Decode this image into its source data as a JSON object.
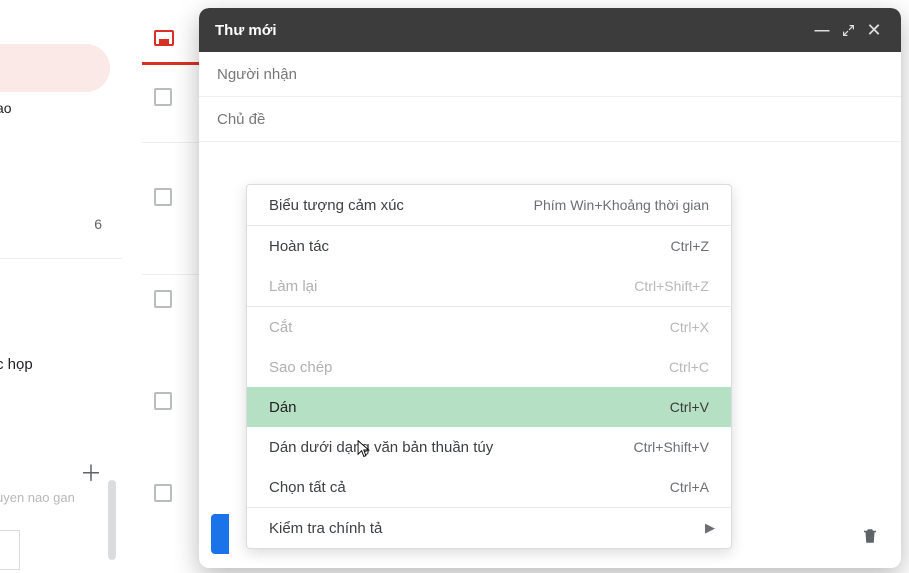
{
  "sidebar": {
    "cut_label_top": "ao",
    "count": "6",
    "category_label": "c họp",
    "cut_label_bottom": "uyen nao gan"
  },
  "compose": {
    "title": "Thư mới",
    "recipients_placeholder": "Người nhận",
    "subject_placeholder": "Chủ đề"
  },
  "ctx": {
    "emoji": {
      "label": "Biểu tượng cảm xúc",
      "shortcut": "Phím Win+Khoảng thời gian"
    },
    "undo": {
      "label": "Hoàn tác",
      "shortcut": "Ctrl+Z"
    },
    "redo": {
      "label": "Làm lại",
      "shortcut": "Ctrl+Shift+Z"
    },
    "cut": {
      "label": "Cắt",
      "shortcut": "Ctrl+X"
    },
    "copy": {
      "label": "Sao chép",
      "shortcut": "Ctrl+C"
    },
    "paste": {
      "label": "Dán",
      "shortcut": "Ctrl+V"
    },
    "paste_plain": {
      "label": "Dán dưới dạng văn bản thuần túy",
      "shortcut": "Ctrl+Shift+V"
    },
    "select_all": {
      "label": "Chọn tất cả",
      "shortcut": "Ctrl+A"
    },
    "spellcheck": {
      "label": "Kiểm tra chính tả",
      "shortcut": ""
    }
  }
}
